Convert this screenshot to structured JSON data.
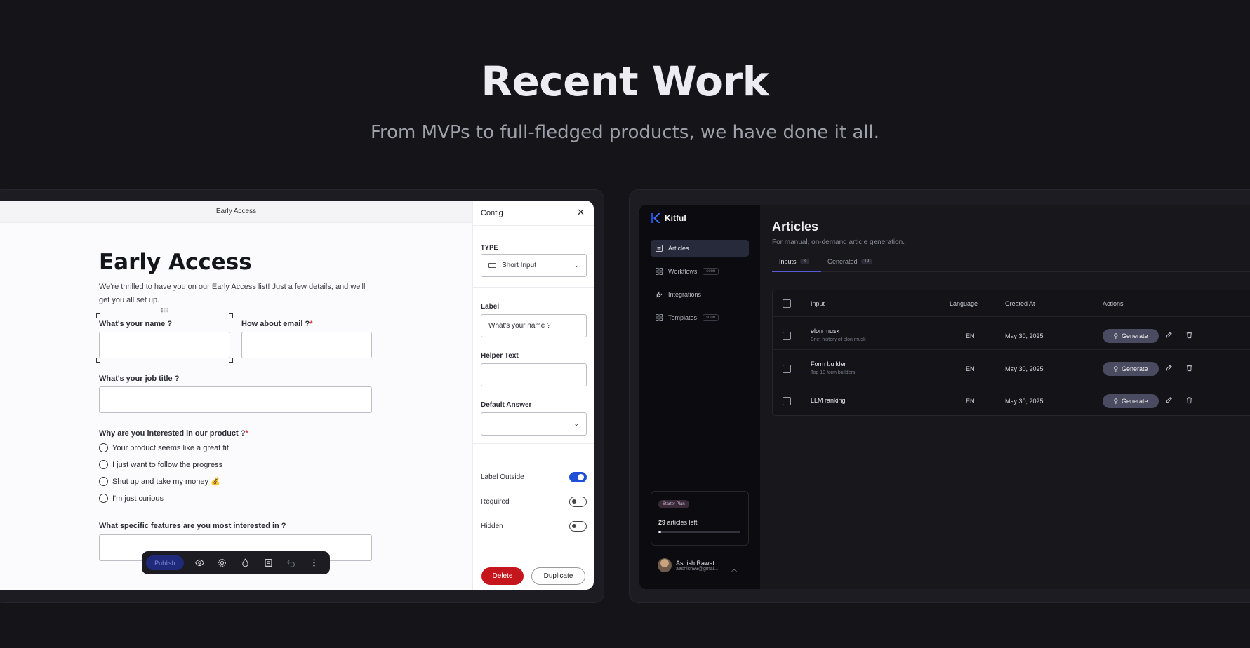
{
  "hero": {
    "title": "Recent Work",
    "subtitle": "From MVPs to full-fledged products, we have done it all."
  },
  "form_builder": {
    "topbar_title": "Early Access",
    "heading": "Early Access",
    "description": "We're thrilled to have you on our Early Access list! Just a few details, and we'll get you all set up.",
    "fields": {
      "name_label": "What's your name ?",
      "email_label": "How about email ?",
      "job_label": "What's your job title ?",
      "interest_label": "Why are you interested in our product ?",
      "features_label": "What specific features are you most interested in ?"
    },
    "required_mark": "*",
    "options": [
      "Your product seems like a great fit",
      "I just want to follow the progress",
      "Shut up and take my money 💰",
      "I'm just curious"
    ],
    "toolbar": {
      "publish": "Publish",
      "icons": [
        "eye-icon",
        "gear-icon",
        "droplet-icon",
        "save-icon",
        "undo-icon",
        "more-icon"
      ]
    }
  },
  "config": {
    "title": "Config",
    "close": "✕",
    "type_label": "TYPE",
    "type_value": "Short Input",
    "label_label": "Label",
    "label_value": "What's your name ?",
    "helper_label": "Helper Text",
    "helper_value": "",
    "default_label": "Default Answer",
    "default_value": "",
    "toggles": [
      {
        "label": "Label Outside",
        "on": true
      },
      {
        "label": "Required",
        "on": false
      },
      {
        "label": "Hidden",
        "on": false
      }
    ],
    "delete": "Delete",
    "duplicate": "Duplicate"
  },
  "kitful": {
    "brand": "Kitful",
    "accent": "#1f4fd6",
    "nav": [
      {
        "label": "Articles",
        "soon": "",
        "active": true
      },
      {
        "label": "Workflows",
        "soon": "soon",
        "active": false
      },
      {
        "label": "Integrations",
        "soon": "",
        "active": false
      },
      {
        "label": "Templates",
        "soon": "soon",
        "active": false
      }
    ],
    "plan": {
      "badge": "Starter Plan",
      "text_count": "29",
      "text_rest": " articles left",
      "used_fraction": 0.03
    },
    "user": {
      "name": "Ashish Rawat",
      "email": "aashish93@gmai..."
    },
    "page": {
      "title": "Articles",
      "subtitle": "For manual, on-demand article generation.",
      "tabs": [
        {
          "label": "Inputs",
          "count": "3"
        },
        {
          "label": "Generated",
          "count": "19"
        }
      ]
    },
    "table": {
      "headers": [
        "Input",
        "Language",
        "Created At",
        "Actions"
      ],
      "rows": [
        {
          "title": "elon musk",
          "sub": "Brief history of elon musk",
          "lang": "EN",
          "date": "May 30, 2025"
        },
        {
          "title": "Form builder",
          "sub": "Top 10 form builders",
          "lang": "EN",
          "date": "May 30, 2025"
        },
        {
          "title": "LLM ranking",
          "sub": "",
          "lang": "EN",
          "date": "May 30, 2025"
        }
      ],
      "generate": "Generate"
    }
  }
}
